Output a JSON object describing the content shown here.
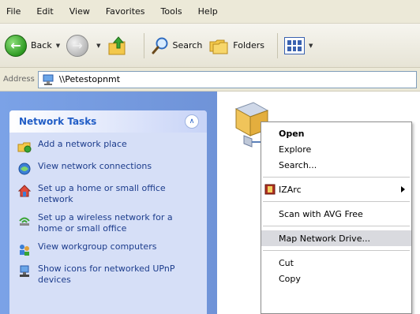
{
  "menubar": {
    "items": [
      "File",
      "Edit",
      "View",
      "Favorites",
      "Tools",
      "Help"
    ]
  },
  "toolbar": {
    "back_label": "Back",
    "search_label": "Search",
    "folders_label": "Folders"
  },
  "address": {
    "label": "Address",
    "value": "\\\\Petestopnmt"
  },
  "task_pane": {
    "title": "Network Tasks",
    "items": [
      {
        "label": "Add a network place",
        "icon": "network-place-icon"
      },
      {
        "label": "View network connections",
        "icon": "network-connections-icon"
      },
      {
        "label": "Set up a home or small office network",
        "icon": "home-network-icon"
      },
      {
        "label": "Set up a wireless network for a home or small office",
        "icon": "wireless-network-icon"
      },
      {
        "label": "View workgroup computers",
        "icon": "workgroup-computers-icon"
      },
      {
        "label": "Show icons for networked UPnP devices",
        "icon": "upnp-devices-icon"
      }
    ]
  },
  "context_menu": {
    "items": [
      {
        "label": "Open"
      },
      {
        "label": "Explore"
      },
      {
        "label": "Search..."
      },
      {
        "label": "IZArc"
      },
      {
        "label": "Scan with AVG Free"
      },
      {
        "label": "Map Network Drive..."
      },
      {
        "label": "Cut"
      },
      {
        "label": "Copy"
      }
    ]
  },
  "colors": {
    "task_pane_blue": "#6f93d8",
    "task_title_blue": "#215dc6",
    "menu_highlight": "#d9dadf"
  }
}
